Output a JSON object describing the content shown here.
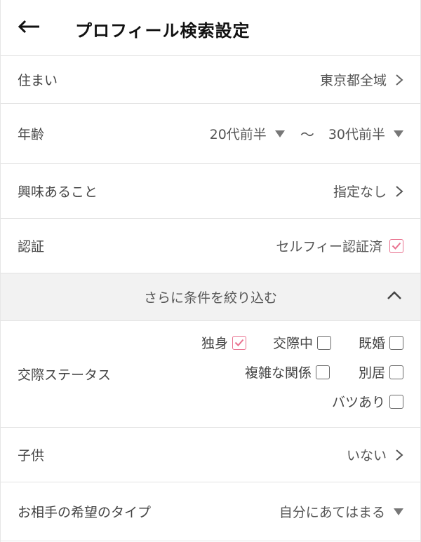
{
  "header": {
    "title": "プロフィール検索設定",
    "back_icon": "arrow-left-icon"
  },
  "residence": {
    "label": "住まい",
    "value": "東京都全域"
  },
  "age": {
    "label": "年齢",
    "from": "20代前半",
    "separator": "〜",
    "to": "30代前半"
  },
  "interests": {
    "label": "興味あること",
    "value": "指定なし"
  },
  "verification": {
    "label": "認証",
    "option": "セルフィー認証済",
    "checked": true
  },
  "more_filters": {
    "label": "さらに条件を絞り込む",
    "expanded": true
  },
  "relationship_status": {
    "label": "交際ステータス",
    "options": [
      {
        "label": "独身",
        "checked": true
      },
      {
        "label": "交際中",
        "checked": false
      },
      {
        "label": "既婚",
        "checked": false
      },
      {
        "label": "複雑な関係",
        "checked": false
      },
      {
        "label": "別居",
        "checked": false
      },
      {
        "label": "バツあり",
        "checked": false
      }
    ]
  },
  "children": {
    "label": "子供",
    "value": "いない"
  },
  "preferred_type": {
    "label": "お相手の希望のタイプ",
    "value": "自分にあてはまる"
  },
  "colors": {
    "accent": "#e9728f",
    "divider": "#e2e2e2",
    "section_bg": "#f2f2f2"
  }
}
